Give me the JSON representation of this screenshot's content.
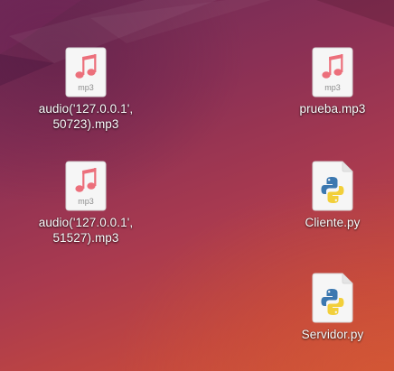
{
  "desktop": {
    "icons": [
      {
        "label": "audio('127.0.0.1',\n50723).mp3",
        "type": "mp3",
        "badge": "mp3",
        "icon": "audio-file-icon"
      },
      {
        "label": "prueba.mp3",
        "type": "mp3",
        "badge": "mp3",
        "icon": "audio-file-icon"
      },
      {
        "label": "audio('127.0.0.1',\n51527).mp3",
        "type": "mp3",
        "badge": "mp3",
        "icon": "audio-file-icon"
      },
      {
        "label": "Cliente.py",
        "type": "python",
        "icon": "python-file-icon"
      },
      {
        "label": "Servidor.py",
        "type": "python",
        "icon": "python-file-icon"
      }
    ]
  },
  "colors": {
    "music_note": "#ec6f7b",
    "python_blue": "#3c78b0",
    "python_yellow": "#f2cf3a",
    "file_bg": "#f6f6f6"
  }
}
